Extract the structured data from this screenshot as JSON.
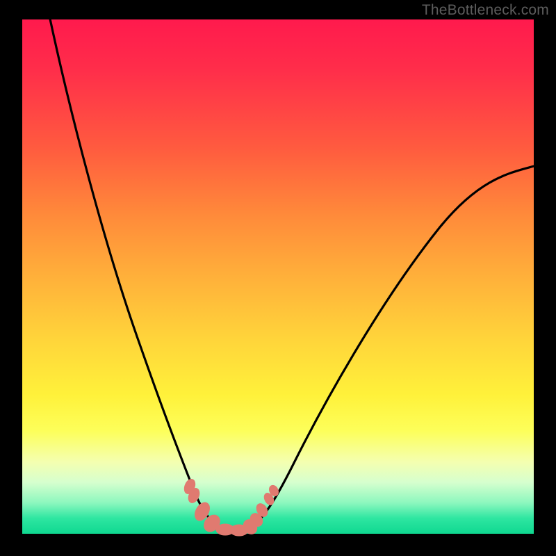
{
  "watermark": "TheBottleneck.com",
  "chart_data": {
    "type": "line",
    "title": "",
    "xlabel": "",
    "ylabel": "",
    "xlim": [
      0,
      100
    ],
    "ylim": [
      0,
      100
    ],
    "grid": false,
    "series": [
      {
        "name": "left-curve",
        "x": [
          5,
          10,
          15,
          20,
          25,
          30,
          33,
          36,
          38,
          40
        ],
        "values": [
          100,
          80,
          58,
          40,
          25,
          12,
          5,
          2,
          0.5,
          0
        ]
      },
      {
        "name": "right-curve",
        "x": [
          44,
          46,
          49,
          53,
          60,
          70,
          80,
          90,
          100
        ],
        "values": [
          0,
          1,
          4,
          10,
          22,
          40,
          55,
          65,
          72
        ]
      },
      {
        "name": "markers",
        "x": [
          32.5,
          33.2,
          35,
          37,
          39.5,
          42,
          44.2,
          45.3,
          46.2,
          47.8,
          48.8
        ],
        "values": [
          9,
          7.5,
          3,
          1.2,
          0.4,
          0.3,
          0.4,
          1.2,
          2.5,
          5,
          7
        ]
      }
    ],
    "gradient_stops": [
      {
        "pos": 0,
        "color": "#ff1a4d"
      },
      {
        "pos": 50,
        "color": "#ffb03a"
      },
      {
        "pos": 80,
        "color": "#fdff5a"
      },
      {
        "pos": 100,
        "color": "#0fd890"
      }
    ]
  }
}
